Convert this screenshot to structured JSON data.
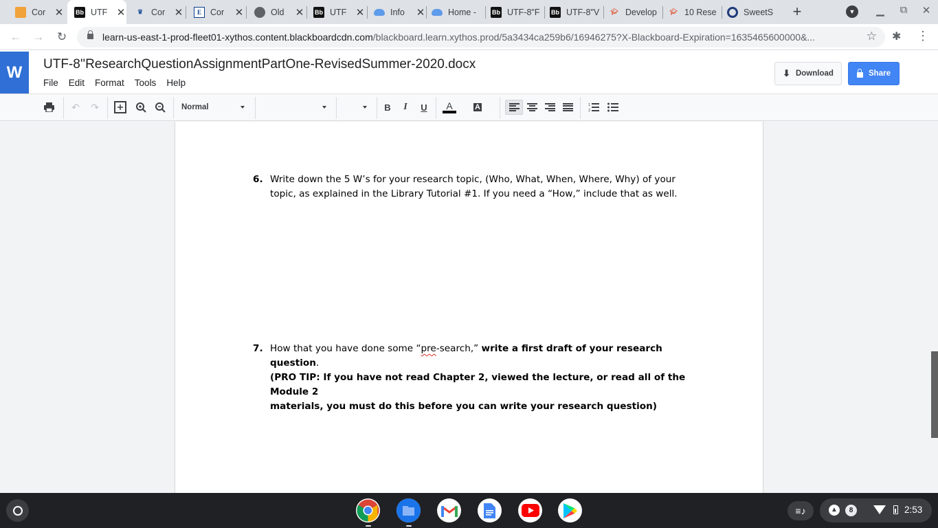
{
  "browser": {
    "tabs": [
      {
        "title": "Cor",
        "icon": "pencil-icon"
      },
      {
        "title": "UTF",
        "icon": "blackboard-icon",
        "active": true
      },
      {
        "title": "Cor",
        "icon": "crown-icon"
      },
      {
        "title": "Cor",
        "icon": "e-icon"
      },
      {
        "title": "Old",
        "icon": "globe-icon"
      },
      {
        "title": "UTF",
        "icon": "blackboard-icon"
      },
      {
        "title": "Info",
        "icon": "cloud-icon"
      },
      {
        "title": "Home -",
        "icon": "cloud-icon"
      },
      {
        "title": "UTF-8\"F",
        "icon": "blackboard-icon"
      },
      {
        "title": "UTF-8\"V",
        "icon": "blackboard-icon"
      },
      {
        "title": "Develop",
        "icon": "graduation-cap-icon"
      },
      {
        "title": "10 Rese",
        "icon": "graduation-cap-icon"
      },
      {
        "title": "SweetS",
        "icon": "ring-icon"
      }
    ],
    "url_host": "learn-us-east-1-prod-fleet01-xythos.content.blackboardcdn.com",
    "url_path": "/blackboard.learn.xythos.prod/5a3434ca259b6/16946275?X-Blackboard-Expiration=1635465600000&..."
  },
  "app": {
    "logo_letter": "W",
    "doc_title": "UTF-8''ResearchQuestionAssignmentPartOne-RevisedSummer-2020.docx",
    "menu": [
      "File",
      "Edit",
      "Format",
      "Tools",
      "Help"
    ],
    "download_label": "Download",
    "share_label": "Share"
  },
  "format_toolbar": {
    "style_value": "Normal",
    "font_value": "",
    "size_value": "",
    "bold": "B",
    "italic": "I",
    "underline": "U",
    "text_color_glyph": "A",
    "highlight_glyph": "A",
    "text_color_hex": "#000000"
  },
  "document": {
    "q6_number": "6.",
    "q6_line1": "Write down the 5 W’s for your research topic, (Who, What, When, Where, Why) of your",
    "q6_line2": "topic, as explained in the Library Tutorial #1. If you need a “How,” include that as well.",
    "q7_number": "7.",
    "q7_line1_a": "How that you have done some “",
    "q7_line1_squig": "pre",
    "q7_line1_b": "-search,” ",
    "q7_line1_bold": "write a first draft of your research question",
    "q7_line1_end": ".",
    "q7_line2": "(PRO TIP: If you have not read Chapter 2, viewed the lecture, or read all of the Module 2",
    "q7_line3": "materials, you must do this before you can write your research question)"
  },
  "shelf": {
    "apps": [
      "chrome-icon",
      "files-icon",
      "gmail-icon",
      "docs-icon",
      "youtube-icon",
      "play-store-icon"
    ],
    "notification_count": "8",
    "time": "2:53"
  },
  "colors": {
    "accent_blue": "#4285f4",
    "docs_logo_blue": "#2f6fd6"
  }
}
